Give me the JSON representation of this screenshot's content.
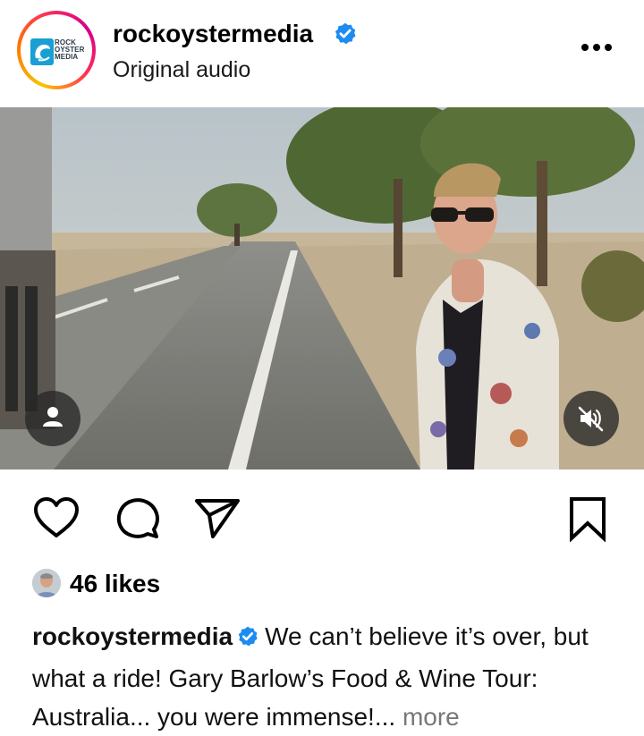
{
  "header": {
    "username": "rockoystermedia",
    "audio_label": "Original audio",
    "avatar_logo_lines": [
      "ROCK",
      "OYSTER",
      "MEDIA"
    ]
  },
  "icons": {
    "verified": "verified-badge-icon",
    "more": "more-options-icon",
    "tag": "person-tag-icon",
    "mute": "muted-speaker-icon",
    "like": "heart-icon",
    "comment": "comment-icon",
    "share": "send-icon",
    "save": "bookmark-icon"
  },
  "post": {
    "likes": "46 likes",
    "caption_user": "rockoystermedia",
    "caption_text": "We can’t believe it’s over, but what a ride! Gary Barlow’s Food & Wine Tour: Australia... you were immense!...",
    "caption_more": "more"
  },
  "colors": {
    "verified_blue": "#1d8cf0",
    "more_link": "#777777"
  }
}
